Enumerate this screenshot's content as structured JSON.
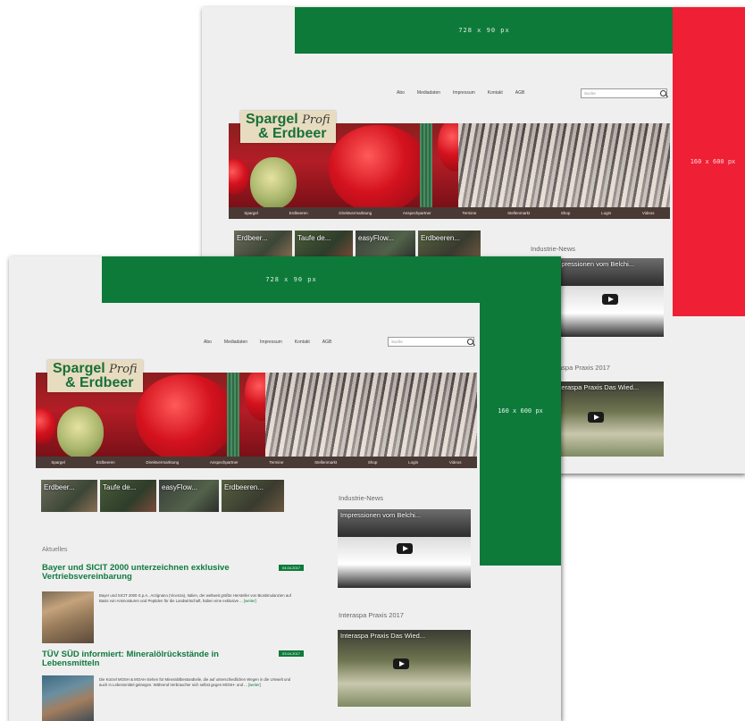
{
  "ads": {
    "leaderboard_label": "728 x 90 px",
    "skyscraper_label": "160 x 600 px",
    "colors": {
      "leaderboard": "#0d7a3a",
      "skyscraper_back": "#ef1f36",
      "skyscraper_front": "#0d7a3a"
    }
  },
  "nav": {
    "items": [
      "Abo",
      "Mediadaten",
      "Impressum",
      "Kontakt",
      "AGB"
    ],
    "search_placeholder": "Suche"
  },
  "logo": {
    "word1": "Spargel",
    "word2": "Profi",
    "word3": "& Erdbeer"
  },
  "menu": [
    "Spargel",
    "Erdbeeren",
    "Direktvermarktung",
    "Anspechpartner",
    "Termine",
    "Stellenmarkt",
    "Shop",
    "Login",
    "Videos"
  ],
  "thumbs": [
    "Erdbeer...",
    "Taufe de...",
    "easyFlow...",
    "Erdbeeren..."
  ],
  "sidebar": {
    "industrie_heading": "Industrie-News",
    "video1_title": "Impressionen vom Belchi...",
    "interaspa_heading": "Interaspa Praxis 2017",
    "video2_title": "Interaspa Praxis Das Wied..."
  },
  "main": {
    "section_label": "Aktuelles",
    "articles": [
      {
        "title": "Bayer und SICIT 2000 unterzeichnen exklusive Vertriebsvereinbarung",
        "date": "04.04.2017",
        "text": "Bayer und SICIT 2000 S.p.A., Arzignano (Vicenza), Italien, der weltweit größte Hersteller von Biostimulanzien auf Basis von Aminosäuren und Peptiden für die Landwirtschaft, haben eine exklusive ...",
        "more": "[weiter]"
      },
      {
        "title": "TÜV SÜD informiert: Mineralölrückstände in Lebensmitteln",
        "date": "03.04.2017",
        "text": "Die Kürzel MOSH & MOAH stehen für Mineralölbestandteile, die auf unterschiedlichen Wegen in die Umwelt und auch in Lebensmittel gelangen. Während Verbraucher sich selbst gegen MOSH- und ...",
        "more": "[weiter]"
      }
    ]
  }
}
